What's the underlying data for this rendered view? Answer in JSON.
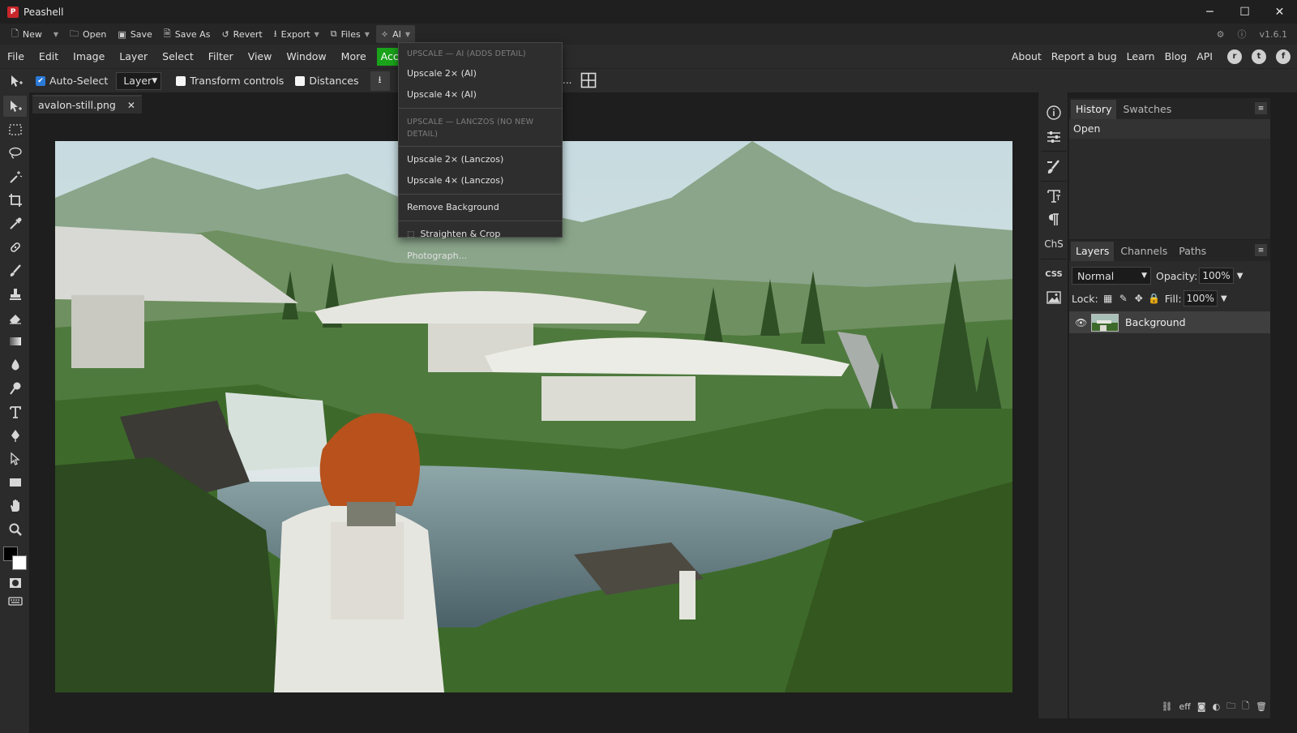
{
  "app": {
    "title": "Peashell",
    "logo_letter": "P",
    "version": "v1.6.1"
  },
  "window_controls": {
    "minimize": "─",
    "maximize": "☐",
    "close": "✕"
  },
  "quickbar": {
    "items": [
      {
        "label": "New",
        "icon": "new-file-icon",
        "caret": true
      },
      {
        "label": "Open",
        "icon": "folder-icon",
        "caret": false
      },
      {
        "label": "Save",
        "icon": "save-icon",
        "caret": false
      },
      {
        "label": "Save As",
        "icon": "save-as-icon",
        "caret": false
      },
      {
        "label": "Revert",
        "icon": "revert-icon",
        "caret": false
      },
      {
        "label": "Export",
        "icon": "export-icon",
        "caret": true
      },
      {
        "label": "Files",
        "icon": "files-icon",
        "caret": true
      },
      {
        "label": "AI",
        "icon": "ai-sparkle-icon",
        "caret": true
      }
    ]
  },
  "menubar": {
    "items": [
      "File",
      "Edit",
      "Image",
      "Layer",
      "Select",
      "Filter",
      "View",
      "Window",
      "More"
    ],
    "account": "Account",
    "right_items": [
      "About",
      "Report a bug",
      "Learn",
      "Blog",
      "API"
    ]
  },
  "options": {
    "auto_select_label": "Auto-Select",
    "auto_select_checked": true,
    "layer_select_value": "Layer",
    "transform_controls_label": "Transform controls",
    "distances_label": "Distances",
    "more": "..."
  },
  "document": {
    "tab_name": "avalon-still.png",
    "close_glyph": "✕"
  },
  "ai_menu": {
    "header_ai": "UPSCALE — AI (ADDS DETAIL)",
    "upscale_2x_ai": "Upscale 2× (AI)",
    "upscale_4x_ai": "Upscale 4× (AI)",
    "header_lanczos": "UPSCALE — LANCZOS (NO NEW DETAIL)",
    "upscale_2x_lanczos": "Upscale 2× (Lanczos)",
    "upscale_4x_lanczos": "Upscale 4× (Lanczos)",
    "remove_background": "Remove Background",
    "straighten_crop": "Straighten & Crop Photograph..."
  },
  "history_panel": {
    "tabs": [
      "History",
      "Swatches"
    ],
    "items": [
      "Open"
    ]
  },
  "layers_panel": {
    "tabs": [
      "Layers",
      "Channels",
      "Paths"
    ],
    "blend_mode": "Normal",
    "opacity_label": "Opacity:",
    "opacity_value": "100%",
    "lock_label": "Lock:",
    "fill_label": "Fill:",
    "fill_value": "100%",
    "layers": [
      {
        "name": "Background",
        "visible": true
      }
    ]
  },
  "icon_column": {
    "chs_label": "ChS",
    "css_label": "CSS"
  },
  "panel_bottom": {
    "effects_label": "eff"
  },
  "colors": {
    "accent": "#2b7ad8",
    "account_green": "#1aa31a",
    "logo_red": "#c8262b"
  }
}
